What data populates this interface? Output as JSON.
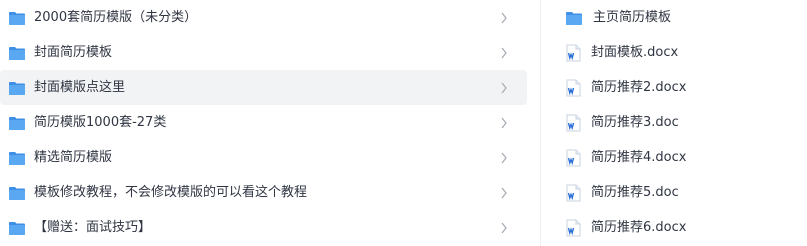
{
  "left_list": {
    "items": [
      {
        "label": "2000套简历模版（未分类）",
        "icon": "folder-icon"
      },
      {
        "label": "封面简历模板",
        "icon": "folder-icon"
      },
      {
        "label": "封面模版点这里",
        "icon": "folder-icon",
        "active": true
      },
      {
        "label": "简历模版1000套-27类",
        "icon": "folder-icon"
      },
      {
        "label": "精选简历模版",
        "icon": "folder-icon"
      },
      {
        "label": "模板修改教程，不会修改模版的可以看这个教程",
        "icon": "folder-icon"
      },
      {
        "label": "【赠送：面试技巧】",
        "icon": "folder-icon"
      }
    ]
  },
  "right_list": {
    "items": [
      {
        "label": "主页简历模板",
        "icon": "folder-icon"
      },
      {
        "label": "封面模板.docx",
        "icon": "word-doc-icon"
      },
      {
        "label": "简历推荐2.docx",
        "icon": "word-doc-icon"
      },
      {
        "label": "简历推荐3.doc",
        "icon": "word-doc-icon"
      },
      {
        "label": "简历推荐4.docx",
        "icon": "word-doc-icon"
      },
      {
        "label": "简历推荐5.doc",
        "icon": "word-doc-icon"
      },
      {
        "label": "简历推荐6.docx",
        "icon": "word-doc-icon"
      }
    ]
  },
  "colors": {
    "folder": "#5aa7f2",
    "folder_tab": "#3f8fe6",
    "doc_blue": "#2b6fd6",
    "active_row": "#f2f3f5",
    "text": "#2f3542",
    "chevron": "#a8adb6"
  }
}
